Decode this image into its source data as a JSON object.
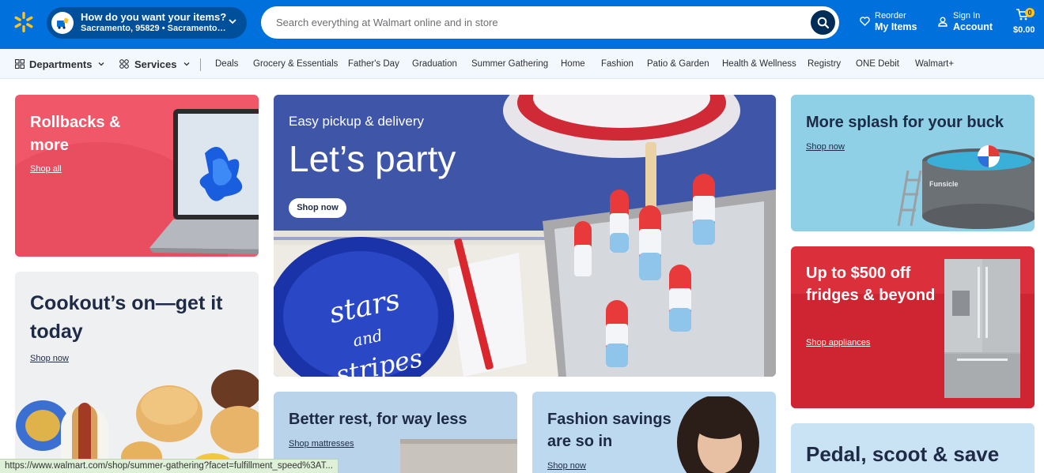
{
  "header": {
    "location_title": "How do you want your items?",
    "location_sub": "Sacramento, 95829 • Sacramento Su...",
    "search_placeholder": "Search everything at Walmart online and in store",
    "reorder_small": "Reorder",
    "reorder_big": "My Items",
    "signin_small": "Sign In",
    "signin_big": "Account",
    "cart_count": "0",
    "cart_total": "$0.00",
    "brand_color": "#0071dc",
    "spark_color": "#ffc220"
  },
  "nav": {
    "departments": "Departments",
    "services": "Services",
    "links": [
      "Deals",
      "Grocery & Essentials",
      "Father's Day",
      "Graduation",
      "Summer Gathering",
      "Home",
      "Fashion",
      "Patio & Garden",
      "Health & Wellness",
      "Registry",
      "ONE Debit",
      "Walmart+"
    ]
  },
  "cards": {
    "rollbacks": {
      "title": "Rollbacks & more",
      "link": "Shop all"
    },
    "cookout": {
      "title": "Cookout’s on—get it today",
      "link": "Shop now"
    },
    "party": {
      "eyebrow": "Easy pickup & delivery",
      "title": "Let’s party",
      "button": "Shop now",
      "plate_text_1": "stars",
      "plate_text_2": "and",
      "plate_text_3": "stripes"
    },
    "splash": {
      "title": "More splash for your buck",
      "link": "Shop now",
      "pool_brand": "Funsicle"
    },
    "fridges": {
      "title": "Up to $500 off fridges & beyond",
      "link": "Shop appliances"
    },
    "rest": {
      "title": "Better rest, for way less",
      "link": "Shop mattresses"
    },
    "fashion": {
      "title": "Fashion savings are so in",
      "link": "Shop now"
    },
    "pedal": {
      "title": "Pedal, scoot & save"
    }
  },
  "status_bar": {
    "url": "https://www.walmart.com/shop/summer-gathering?facet=fulfillment_speed%3AT..."
  }
}
